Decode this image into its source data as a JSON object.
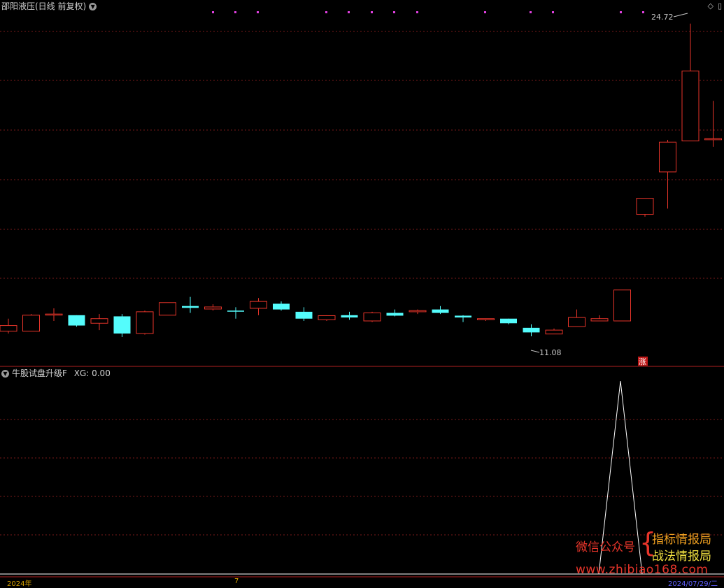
{
  "main_panel": {
    "title": "邵阳液压(日线 前复权)",
    "max_label": "24.72",
    "min_label": "11.08",
    "zhang_badge": "涨",
    "grid_color": "#7a1a1a",
    "up_color": "#e8352a",
    "down_color": "#54fcfc"
  },
  "indicator_panel": {
    "title": "牛股试盘升级F",
    "value_label": "XG: 0.00"
  },
  "top_icons": [
    "diamond-icon",
    "window-icon"
  ],
  "watermark": {
    "left_text": "微信公众号",
    "brace": "{",
    "right_line1": "指标情报局",
    "right_line2": "战法情报局",
    "url": "www.zhibiao168.com"
  },
  "axis": {
    "date_left": "2024年",
    "date_mid": "7",
    "date_right": "2024/07/29/二"
  },
  "chart_data": {
    "type": "candlestick",
    "ylim": [
      10.5,
      25.2
    ],
    "candles": [
      {
        "o": 11.3,
        "h": 11.85,
        "l": 11.2,
        "c": 11.55
      },
      {
        "o": 11.3,
        "h": 12.05,
        "l": 11.3,
        "c": 12.0
      },
      {
        "o": 12.05,
        "h": 12.3,
        "l": 11.75,
        "c": 12.05
      },
      {
        "o": 12.0,
        "h": 12.0,
        "l": 11.5,
        "c": 11.55
      },
      {
        "o": 11.65,
        "h": 12.05,
        "l": 11.35,
        "c": 11.85
      },
      {
        "o": 11.95,
        "h": 12.05,
        "l": 11.05,
        "c": 11.2
      },
      {
        "o": 11.2,
        "h": 12.2,
        "l": 11.15,
        "c": 12.15
      },
      {
        "o": 12.0,
        "h": 12.55,
        "l": 12.0,
        "c": 12.55
      },
      {
        "o": 12.4,
        "h": 12.8,
        "l": 12.1,
        "c": 12.32
      },
      {
        "o": 12.27,
        "h": 12.48,
        "l": 12.2,
        "c": 12.36
      },
      {
        "o": 12.2,
        "h": 12.35,
        "l": 11.85,
        "c": 12.18
      },
      {
        "o": 12.3,
        "h": 12.75,
        "l": 12.0,
        "c": 12.6
      },
      {
        "o": 12.5,
        "h": 12.6,
        "l": 12.2,
        "c": 12.25
      },
      {
        "o": 12.15,
        "h": 12.35,
        "l": 11.75,
        "c": 11.85
      },
      {
        "o": 11.8,
        "h": 12.0,
        "l": 11.75,
        "c": 11.98
      },
      {
        "o": 12.0,
        "h": 12.15,
        "l": 11.8,
        "c": 11.9
      },
      {
        "o": 11.75,
        "h": 12.15,
        "l": 11.7,
        "c": 12.1
      },
      {
        "o": 12.1,
        "h": 12.25,
        "l": 11.95,
        "c": 11.98
      },
      {
        "o": 12.15,
        "h": 12.25,
        "l": 12.05,
        "c": 12.2
      },
      {
        "o": 12.25,
        "h": 12.4,
        "l": 12.05,
        "c": 12.1
      },
      {
        "o": 11.98,
        "h": 12.0,
        "l": 11.7,
        "c": 11.9
      },
      {
        "o": 11.8,
        "h": 11.85,
        "l": 11.75,
        "c": 11.85
      },
      {
        "o": 11.85,
        "h": 11.85,
        "l": 11.6,
        "c": 11.65
      },
      {
        "o": 11.45,
        "h": 11.6,
        "l": 11.08,
        "c": 11.25
      },
      {
        "o": 11.18,
        "h": 11.42,
        "l": 11.18,
        "c": 11.35
      },
      {
        "o": 11.5,
        "h": 12.25,
        "l": 11.5,
        "c": 11.9
      },
      {
        "o": 11.75,
        "h": 12.0,
        "l": 11.75,
        "c": 11.85
      },
      {
        "o": 11.75,
        "h": 13.1,
        "l": 11.75,
        "c": 13.1
      },
      {
        "o": 16.4,
        "h": 16.9,
        "l": 16.3,
        "c": 17.1
      },
      {
        "o": 18.25,
        "h": 19.65,
        "l": 16.65,
        "c": 19.55
      },
      {
        "o": 19.6,
        "h": 24.72,
        "l": 19.6,
        "c": 22.65
      },
      {
        "o": 19.7,
        "h": 21.35,
        "l": 19.35,
        "c": 19.7
      }
    ]
  }
}
